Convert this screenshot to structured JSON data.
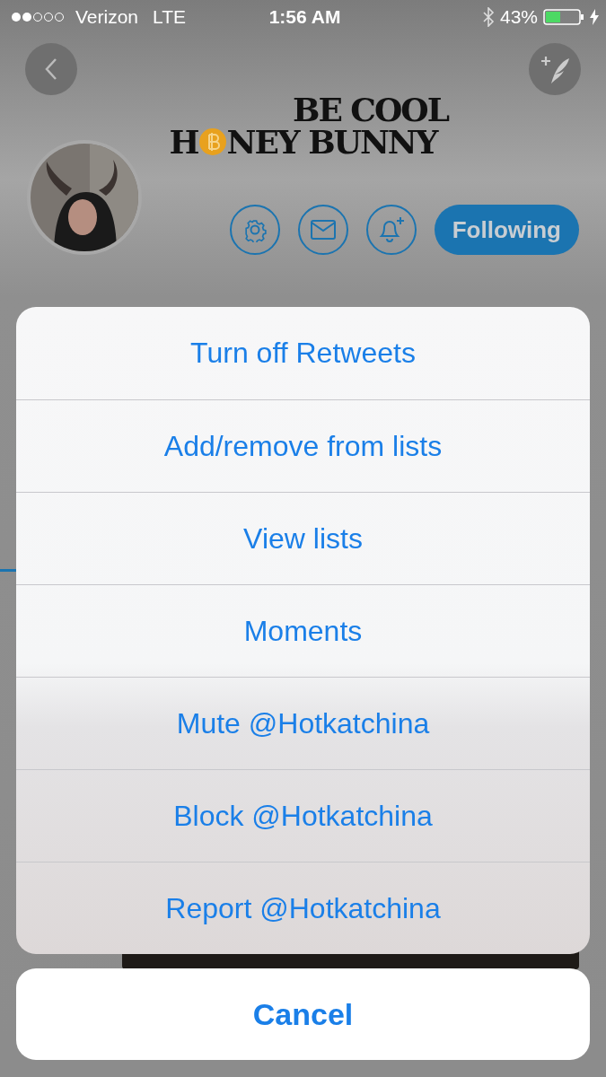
{
  "status_bar": {
    "carrier": "Verizon",
    "network": "LTE",
    "time": "1:56 AM",
    "battery": "43%"
  },
  "banner": {
    "line_1": "BE COOL",
    "line_2_start": "H",
    "line_2_end": "NEY BUNNY"
  },
  "profile_actions": {
    "follow_button": "Following"
  },
  "action_sheet": {
    "options": [
      "Turn off Retweets",
      "Add/remove from lists",
      "View lists",
      "Moments",
      "Mute @Hotkatchina",
      "Block @Hotkatchina",
      "Report @Hotkatchina"
    ],
    "cancel": "Cancel"
  }
}
